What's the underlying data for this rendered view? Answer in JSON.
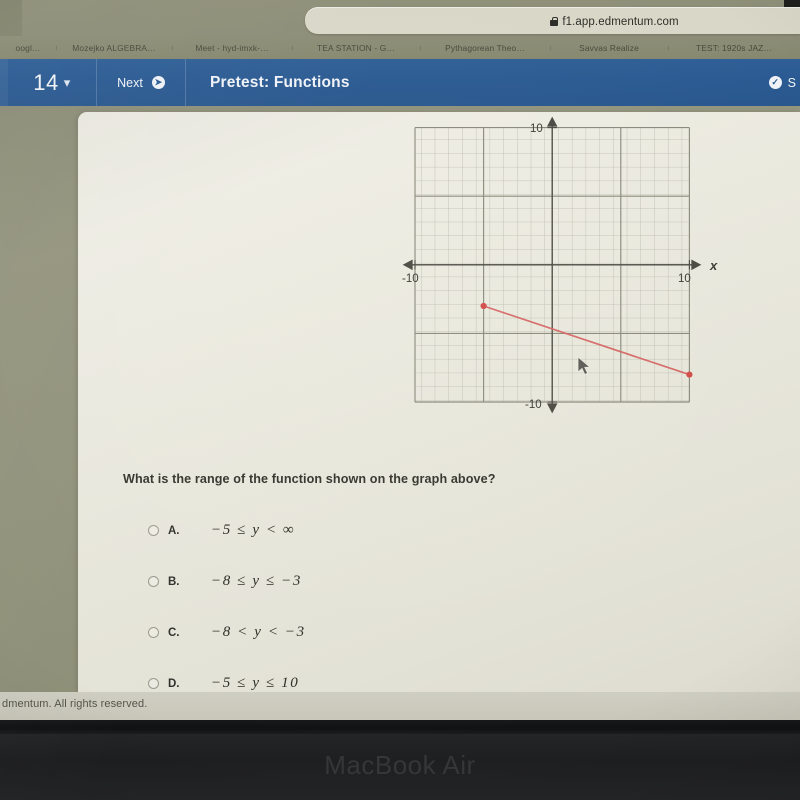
{
  "browser": {
    "url": "f1.app.edmentum.com",
    "lock_icon": "lock-icon",
    "bookmarks": [
      {
        "label": "oogl…"
      },
      {
        "label": "Mozejko ALGEBRA…"
      },
      {
        "label": "Meet - hyd-imxk-…"
      },
      {
        "label": "TEA STATION - G…"
      },
      {
        "label": "Pythagorean Theo…"
      },
      {
        "label": "Savvas Realize"
      },
      {
        "label": "TEST: 1920s JAZ…"
      }
    ]
  },
  "appbar": {
    "question_number": "14",
    "chevron_icon": "chevron-down-icon",
    "next_label": "Next",
    "next_icon": "next-circle-arrow-icon",
    "title": "Pretest: Functions",
    "save_icon": "check-circle-icon",
    "save_label": "S"
  },
  "question": {
    "prompt": "What is the range of the function shown on the graph above?",
    "options": [
      {
        "letter": "A.",
        "text": "−5  ≤  y  <  ∞",
        "selected": false
      },
      {
        "letter": "B.",
        "text": "−8  ≤  y  ≤  −3",
        "selected": false
      },
      {
        "letter": "C.",
        "text": "−8  <  y  <  −3",
        "selected": false
      },
      {
        "letter": "D.",
        "text": "−5  ≤  y  ≤  10",
        "selected": false
      }
    ]
  },
  "chart_data": {
    "type": "line",
    "title": "",
    "xlabel": "x",
    "ylabel": "",
    "xlim": [
      -10,
      10
    ],
    "ylim": [
      -10,
      10
    ],
    "grid": true,
    "x_tick_labels": [
      "-10",
      "10"
    ],
    "y_tick_labels": [
      "10",
      "-10"
    ],
    "axis_arrow_labels": {
      "x_right": "x"
    },
    "series": [
      {
        "name": "segment",
        "color": "#d4625f",
        "endpoints_marked": true,
        "x": [
          -5,
          10
        ],
        "y": [
          -3,
          -8
        ]
      }
    ],
    "cursor": {
      "x": -1.4,
      "y": -7.2,
      "icon": "mouse-pointer-icon"
    }
  },
  "footer": {
    "copyright": "dmentum. All rights reserved."
  },
  "device": {
    "brand": "MacBook Air"
  },
  "colors": {
    "appbar": "#2a5a92",
    "line": "#d4625f",
    "sheet": "#e9e8dd",
    "chrome": "#8c8e78"
  }
}
